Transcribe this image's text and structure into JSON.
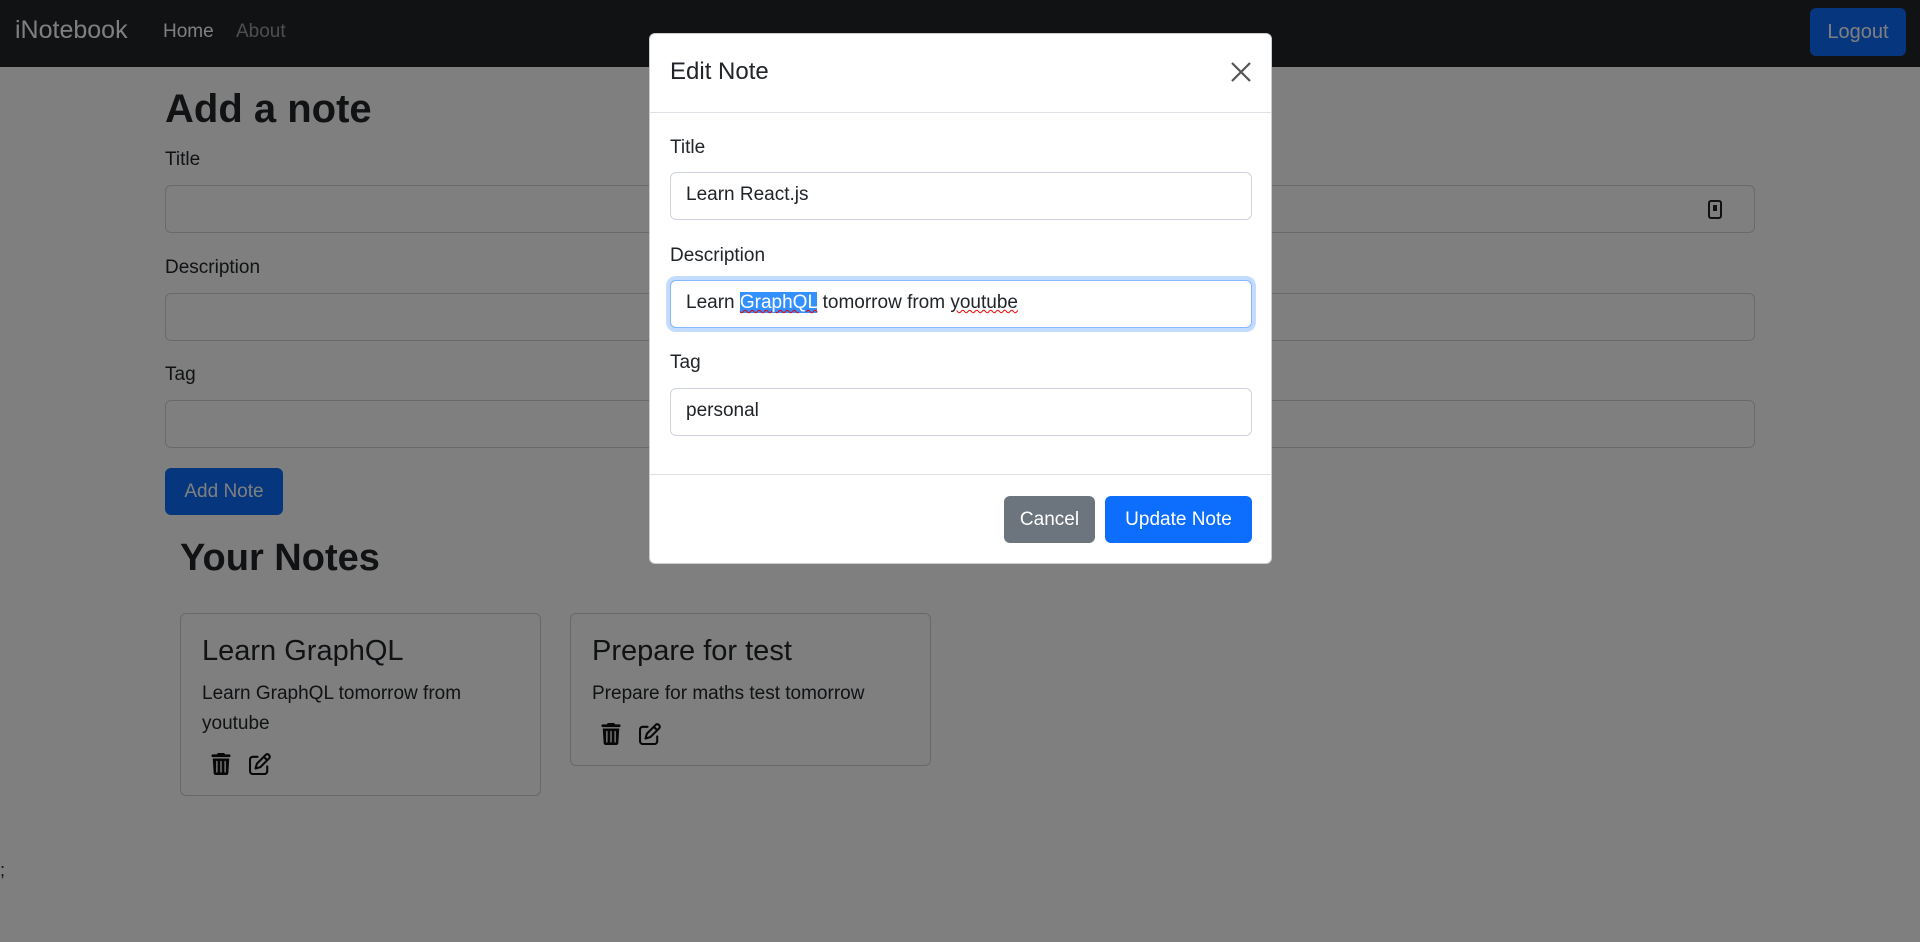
{
  "navbar": {
    "brand": "iNotebook",
    "links": [
      {
        "label": "Home",
        "active": true
      },
      {
        "label": "About",
        "active": false
      }
    ],
    "logout_label": "Logout"
  },
  "add_note": {
    "heading": "Add a note",
    "fields": [
      {
        "label": "Title",
        "value": ""
      },
      {
        "label": "Description",
        "value": ""
      },
      {
        "label": "Tag",
        "value": ""
      }
    ],
    "submit_label": "Add Note"
  },
  "notes_section": {
    "heading": "Your Notes",
    "notes": [
      {
        "title": "Learn GraphQL",
        "description": "Learn GraphQL tomorrow from youtube"
      },
      {
        "title": "Prepare for test",
        "description": "Prepare for maths test tomorrow"
      }
    ]
  },
  "stray_text": ";",
  "modal": {
    "title": "Edit Note",
    "fields": {
      "title": {
        "label": "Title",
        "value": "Learn React.js"
      },
      "description": {
        "label": "Description",
        "value": "Learn GraphQL tomorrow from youtube",
        "parts": {
          "before": "Learn ",
          "selected": "GraphQL",
          "middle": " tomorrow from ",
          "misspelled": "youtube"
        }
      },
      "tag": {
        "label": "Tag",
        "value": "personal"
      }
    },
    "cancel_label": "Cancel",
    "update_label": "Update Note"
  },
  "colors": {
    "primary": "#0d6efd",
    "secondary": "#6c757d",
    "navbar": "#212529",
    "selection": "#3390ff"
  }
}
